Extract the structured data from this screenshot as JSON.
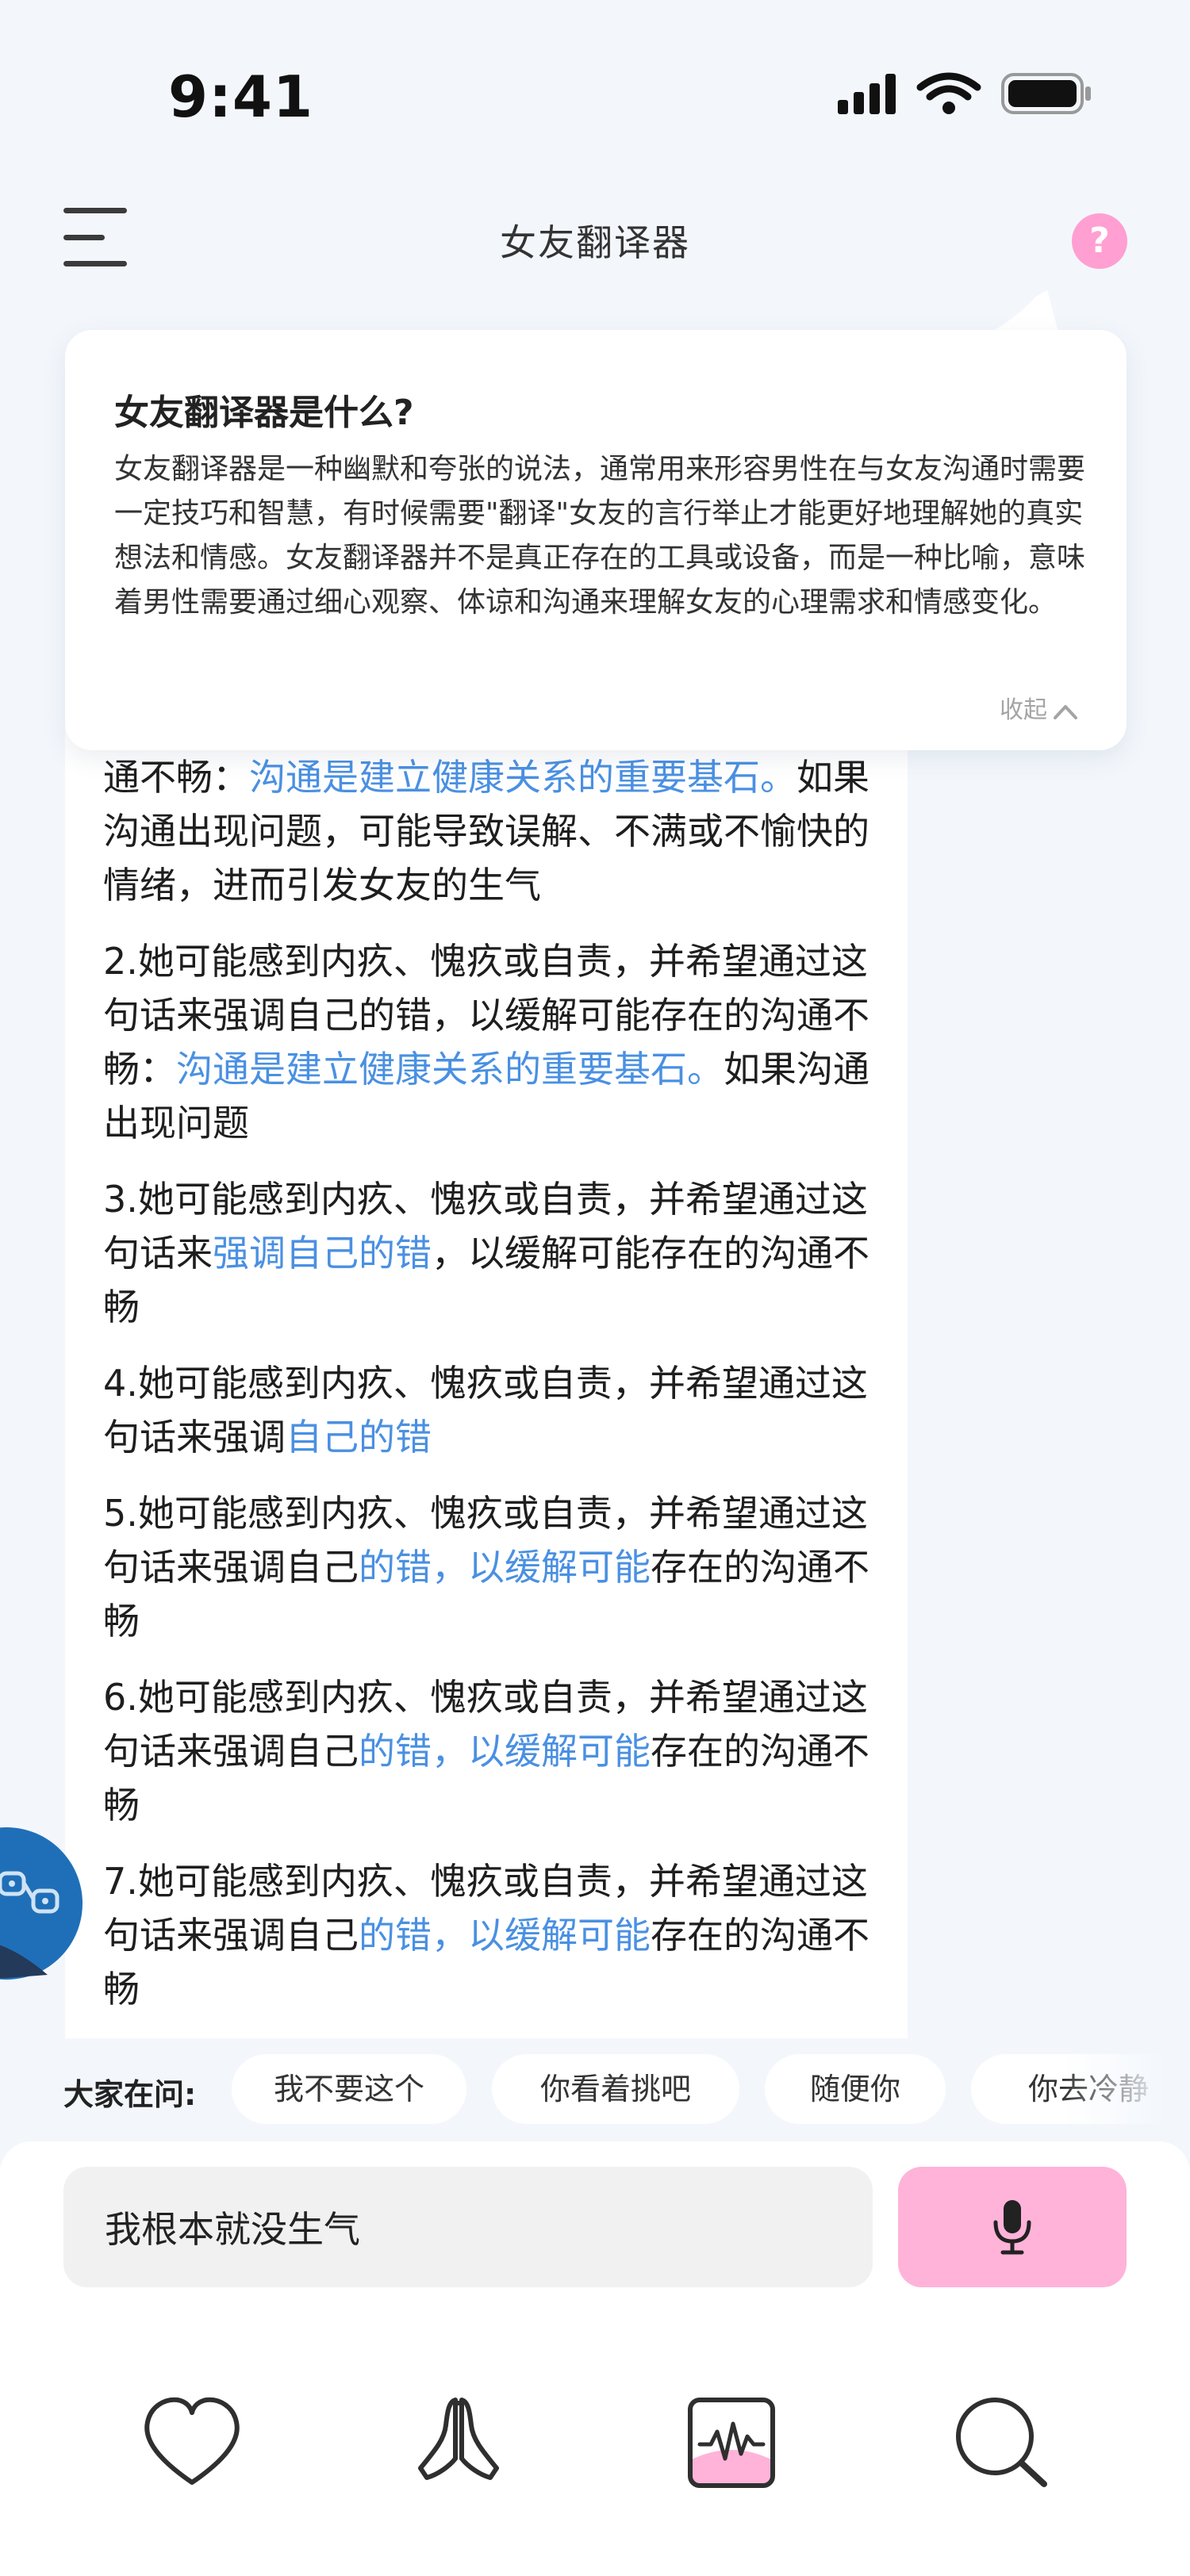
{
  "status_bar": {
    "time": "9:41"
  },
  "header": {
    "title": "女友翻译器",
    "help_symbol": "?"
  },
  "popup": {
    "title": "女友翻译器是什么?",
    "body": "女友翻译器是一种幽默和夸张的说法，通常用来形容男性在与女友沟通时需要一定技巧和智慧，有时候需要\"翻译\"女友的言行举止才能更好地理解她的真实想法和情感。女友翻译器并不是真正存在的工具或设备，而是一种比喻，意味着男性需要通过细心观察、体谅和沟通来理解女友的心理需求和情感变化。",
    "collapse_label": "收起"
  },
  "answer": {
    "p0": {
      "a": "通不畅：",
      "b": "沟通是建立健康关系的重要基石。",
      "c": "如果沟通出现问题，可能导致误解、不满或不愉快的情绪，进而引发女友的生气"
    },
    "p2": {
      "a": "2.她可能感到内疚、愧疚或自责，并希望通过这句话来强调自己的错，以缓解可能存在的沟通不畅：",
      "b": "沟通是建立健康关系的重要基石。",
      "c": "如果沟通出现问题"
    },
    "p3": {
      "a": "3.她可能感到内疚、愧疚或自责，并希望通过这句话来",
      "b": "强调自己的错",
      "c": "，以缓解可能存在的沟通不畅"
    },
    "p4": {
      "a": "4.她可能感到内疚、愧疚或自责，并希望通过这句话来强调",
      "b": "自己的错"
    },
    "p5": {
      "a": "5.她可能感到内疚、愧疚或自责，并希望通过这句话来强调自己",
      "b": "的错，以缓解可能",
      "c": "存在的沟通不畅"
    },
    "p6": {
      "a": "6.她可能感到内疚、愧疚或自责，并希望通过这句话来强调自己",
      "b": "的错，以缓解可能",
      "c": "存在的沟通不畅"
    },
    "p7": {
      "a": "7.她可能感到内疚、愧疚或自责，并希望通过这句话来强调自己",
      "b": "的错，以缓解可能",
      "c": "存在的沟通不畅"
    }
  },
  "suggestions": {
    "label": "大家在问:",
    "items": [
      "我不要这个",
      "你看着挑吧",
      "随便你",
      "你去冷静"
    ]
  },
  "input": {
    "value": "我根本就没生气"
  },
  "tabbar": {
    "icons": [
      "heart-icon",
      "pray-hands-icon",
      "waveform-icon",
      "search-icon"
    ]
  },
  "colors": {
    "accent_pink": "#ffb3d9",
    "help_pink": "#ff9fd2",
    "highlight_blue": "#4a90e2",
    "background": "#f3f7fc"
  }
}
